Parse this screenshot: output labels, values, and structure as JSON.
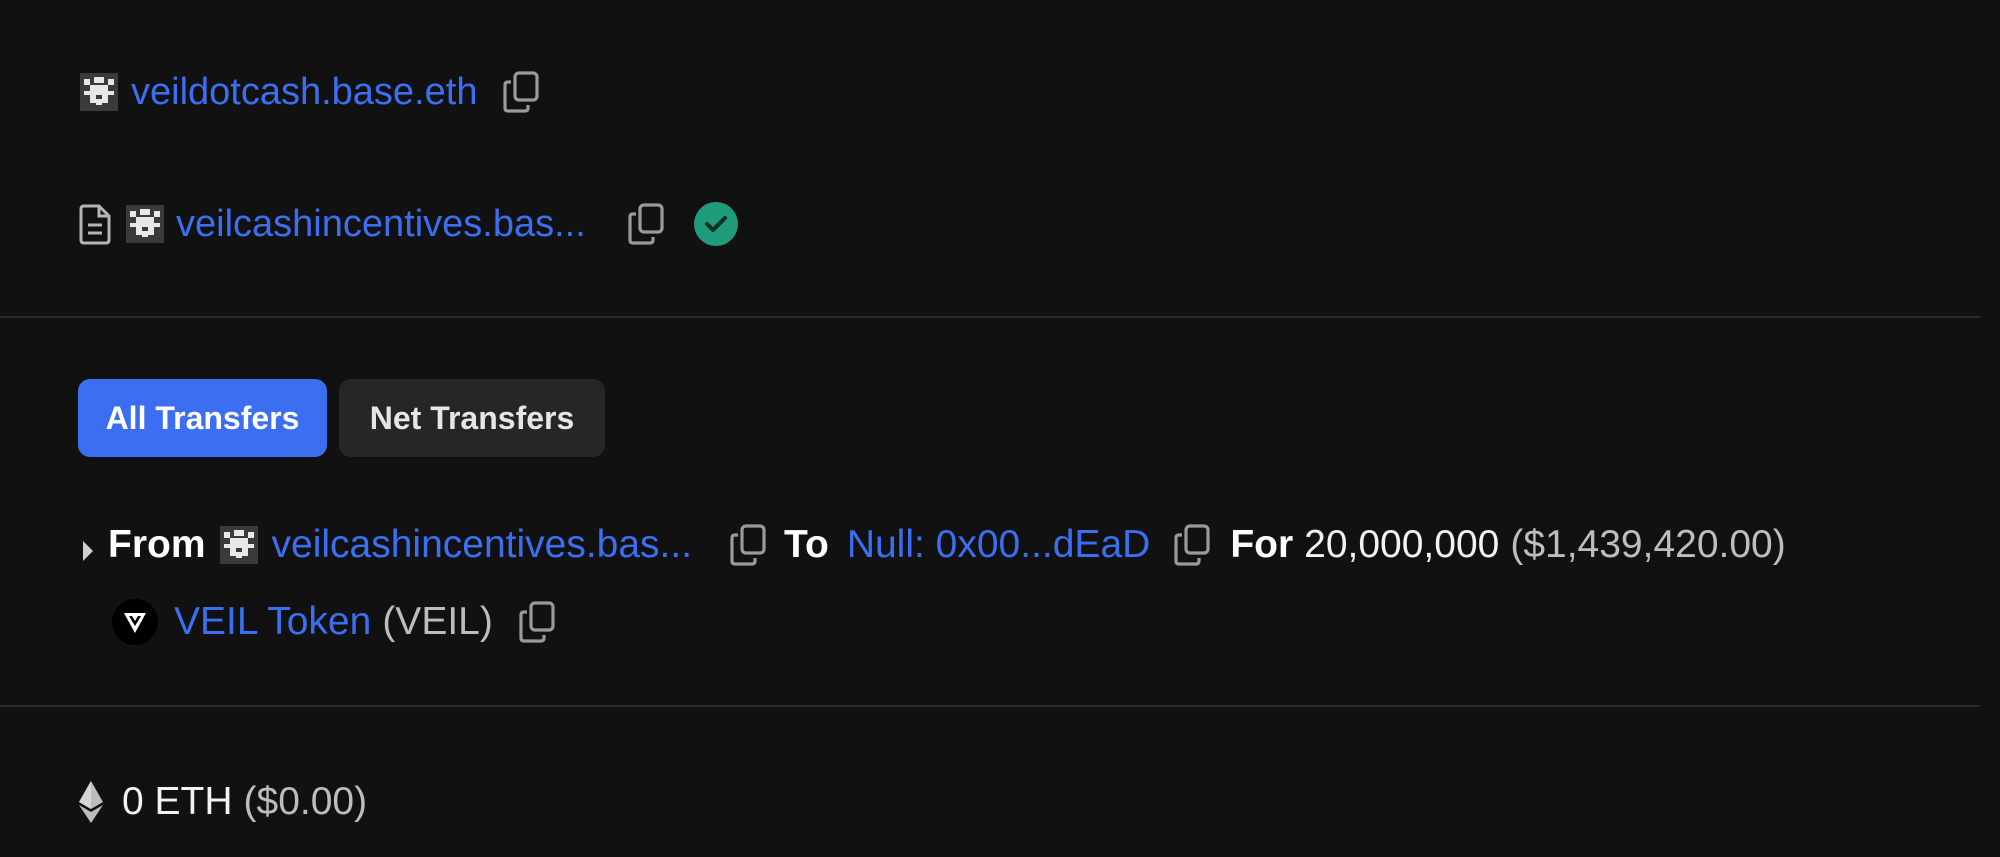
{
  "owner": {
    "name": "veildotcash.base.eth",
    "avatar_icon": "identicon-icon",
    "copy_icon": "copy-icon"
  },
  "contract": {
    "doc_icon": "document-icon",
    "name": "veilcashincentives.bas...",
    "avatar_icon": "identicon-icon",
    "copy_icon": "copy-icon",
    "verified_icon": "verified-check-icon"
  },
  "tabs": {
    "all": "All Transfers",
    "net": "Net Transfers",
    "active": "all"
  },
  "transfer": {
    "expand_icon": "caret-right-icon",
    "from_label": "From",
    "from_name": "veilcashincentives.bas...",
    "to_label": "To",
    "to_name": "Null: 0x00...dEaD",
    "for_label": "For",
    "amount": "20,000,000",
    "usd": "($1,439,420.00)",
    "token_name": "VEIL Token",
    "token_symbol": "(VEIL)",
    "token_icon": "veil-logo-icon"
  },
  "value": {
    "icon": "ethereum-icon",
    "amount": "0 ETH",
    "usd": "($0.00)"
  },
  "colors": {
    "background": "#111111",
    "link": "#3b6ef0",
    "accent": "#3b6ef0",
    "verified": "#1f9b7c",
    "divider": "#2a2a2a"
  }
}
